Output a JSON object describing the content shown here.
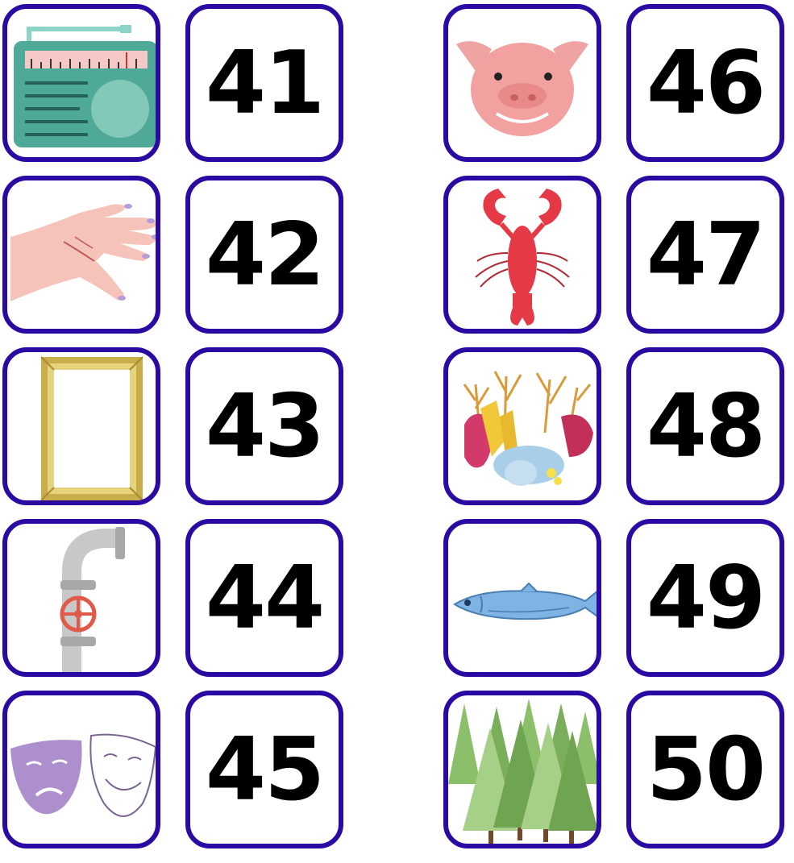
{
  "numbers": [
    "41",
    "42",
    "43",
    "44",
    "45",
    "46",
    "47",
    "48",
    "49",
    "50"
  ],
  "pictures": [
    "radio",
    "hand",
    "picture-frame",
    "water-pipe",
    "theater-masks",
    "pig",
    "lobster",
    "coral",
    "fish",
    "forest"
  ],
  "colors": {
    "border": "#2a0aa3",
    "text": "#000000"
  }
}
